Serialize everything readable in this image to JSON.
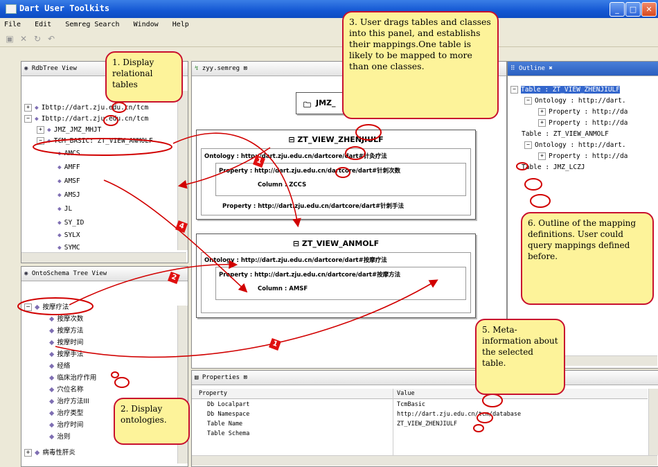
{
  "window": {
    "title": "Dart User Toolkits"
  },
  "menu": [
    "File",
    "Edit",
    "Semreg Search",
    "Window",
    "Help"
  ],
  "rdb_view": {
    "tab": "RdbTree View",
    "items": [
      "Ibttp://dart.zju.edu.cn/tcm",
      "Ibttp://dart.zju.edu.cn/tcm",
      "JMZ_JMZ_MHJT",
      "TCM_BASIC: ZT_VIEW_ANMOLF",
      "AMCS",
      "AMFF",
      "AMSF",
      "AMSJ",
      "JL",
      "SY_ID",
      "SYLX",
      "SYMC"
    ]
  },
  "onto_view": {
    "tab": "OntoSchema Tree View",
    "items": [
      "按摩疗法",
      "按摩次数",
      "按摩方法",
      "按摩时间",
      "按摩手法",
      "经络",
      "临床治疗作用",
      "穴位名称",
      "治疗方法III",
      "治疗类型",
      "治疗时间",
      "治则",
      "病毒性肝炎"
    ]
  },
  "editor": {
    "tab": "zyy.semreg",
    "top_box": "JMZ_",
    "box1": {
      "title": "ZT_VIEW_ZHENJIULF",
      "ontology": "Ontology : http://dart.zju.edu.cn/dartcore/dart#针灸疗法",
      "property": "Property : http://dart.zju.edu.cn/dartcore/dart#针刺次数",
      "column": "Column : ZCCS",
      "property2": "Property : http://dart.zju.edu.cn/dartcore/dart#针刺手法"
    },
    "box2": {
      "title": "ZT_VIEW_ANMOLF",
      "ontology": "Ontology : http://dart.zju.edu.cn/dartcore/dart#按摩疗法",
      "property": "Property : http://dart.zju.edu.cn/dartcore/dart#按摩方法",
      "column": "Column : AMSF"
    }
  },
  "outline": {
    "tab": "Outline",
    "lines": [
      "Table : ZT_VIEW_ZHENJIULF",
      "Ontology : http://dart.",
      "Property : http://da",
      "Property : http://da",
      "Table : ZT_VIEW_ANMOLF",
      "Ontology : http://dart.",
      "Property : http://da",
      "Table : JMZ_LCZJ"
    ]
  },
  "properties": {
    "tab": "Properties",
    "headers": [
      "Property",
      "Value"
    ],
    "rows": [
      {
        "k": "Db Localpart",
        "v": "TcmBasic"
      },
      {
        "k": "Db Namespace",
        "v": "http://dart.zju.edu.cn/tcm/database"
      },
      {
        "k": "Table Name",
        "v": "ZT_VIEW_ZHENJIULF"
      },
      {
        "k": "Table Schema",
        "v": ""
      }
    ]
  },
  "callouts": {
    "c1": "1. Display relational tables",
    "c2": "2. Display ontologies.",
    "c3": "3. User drags tables and classes into this panel, and establishs their mappings.One table is likely to be mapped to more than one classes.",
    "c5": "5. Meta-information about the selected table.",
    "c6": "6. Outline of the mapping definitions. User could query mappings defined before."
  },
  "badges": [
    "1",
    "2",
    "1",
    "4"
  ],
  "colors": {
    "callout_bg": "#fdf39a",
    "callout_border": "#c8102e",
    "arrow": "#d10000",
    "titlebar": "#1457d3"
  }
}
